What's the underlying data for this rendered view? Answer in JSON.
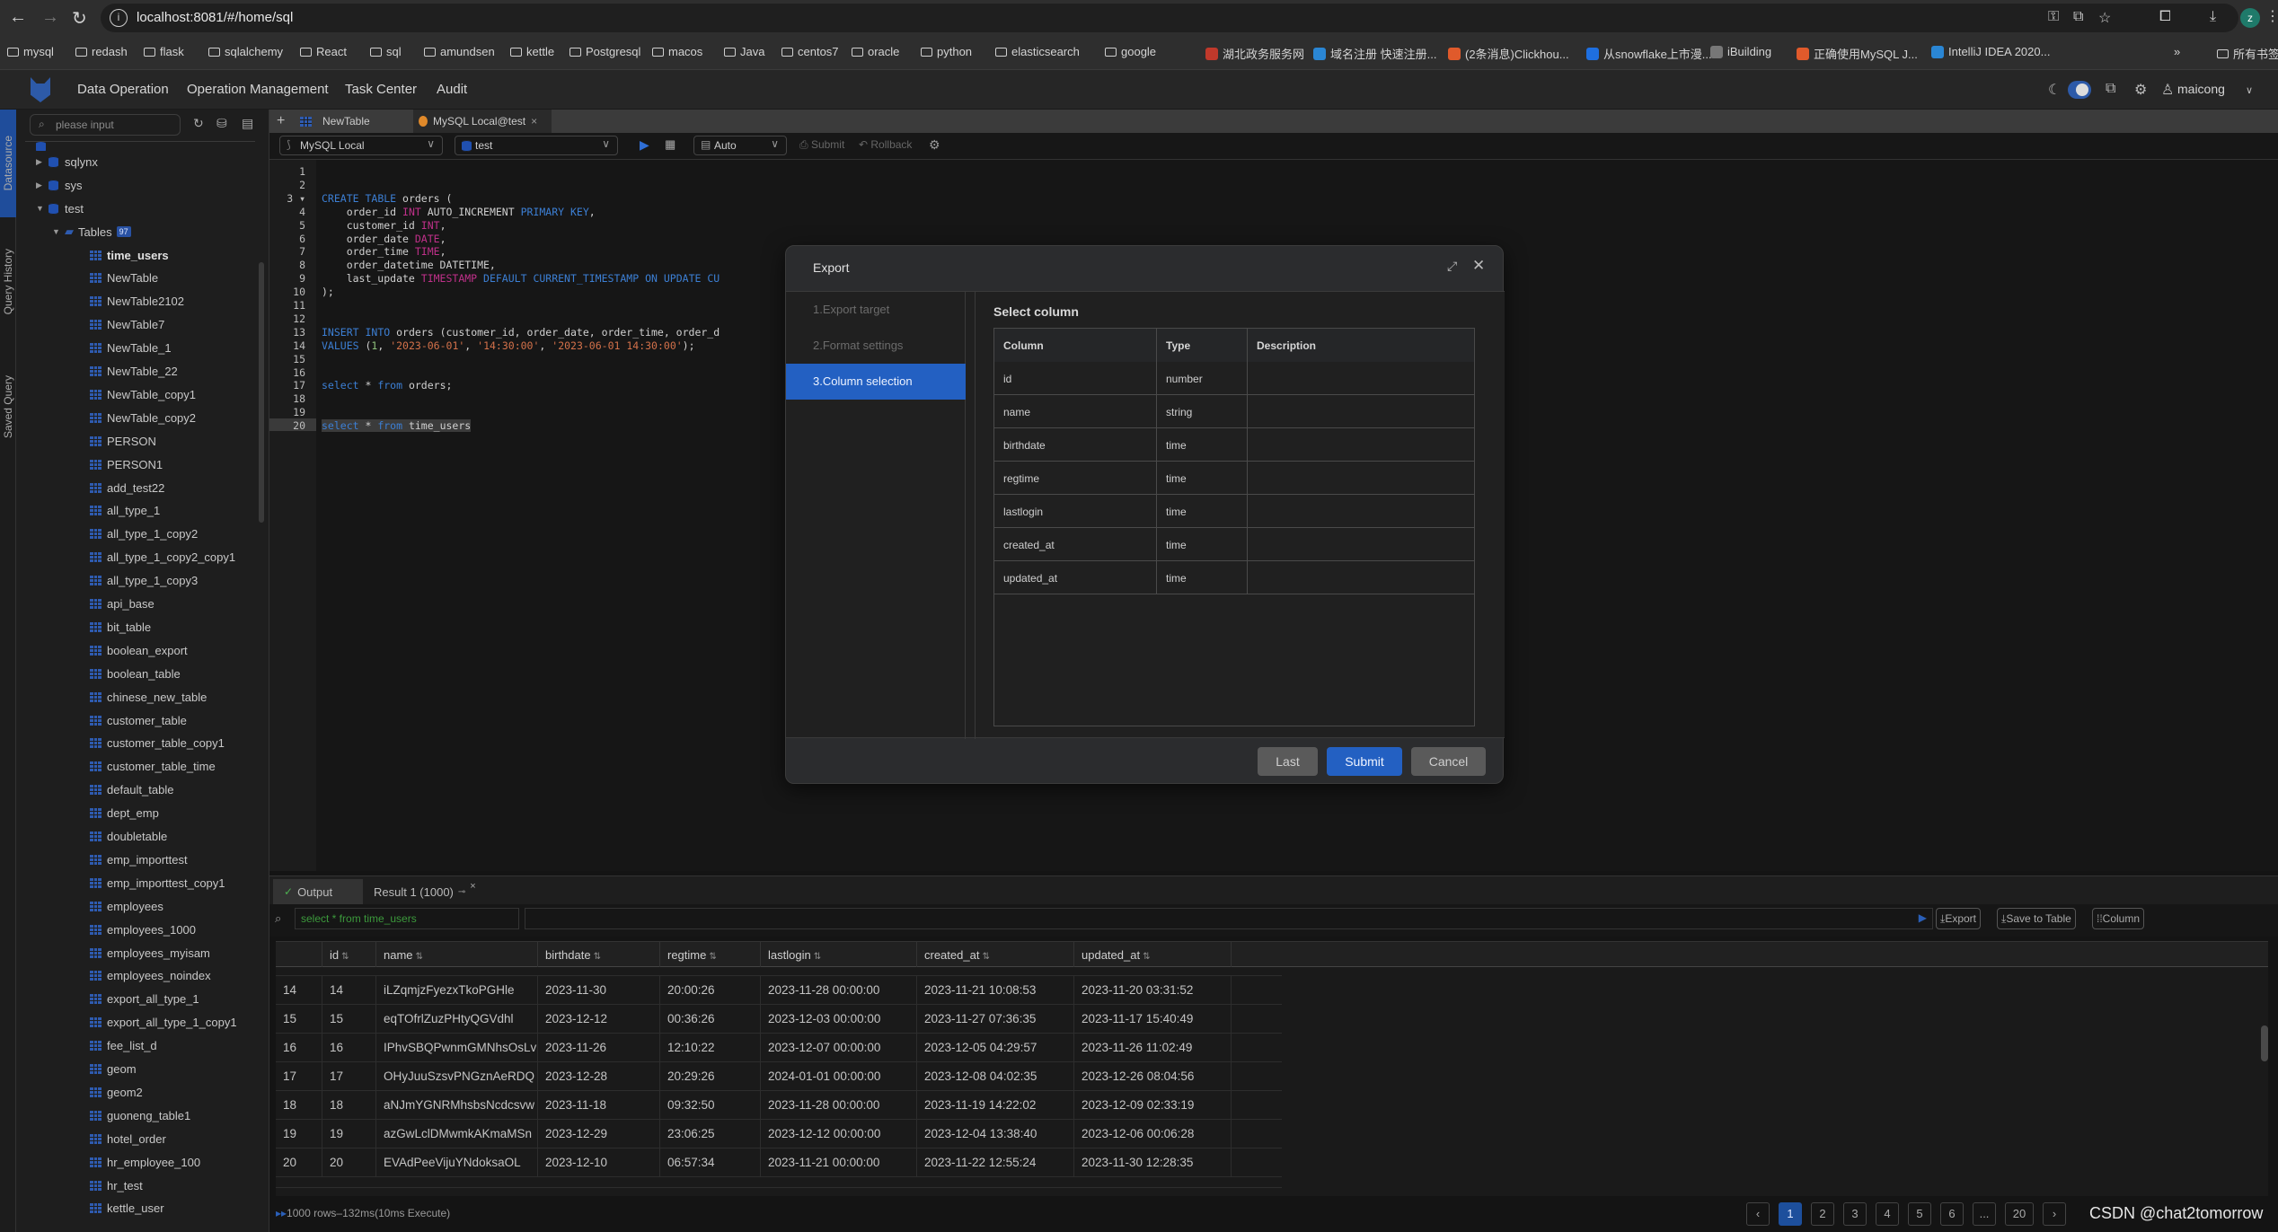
{
  "browser": {
    "url": "localhost:8081/#/home/sql",
    "avatar_letter": "z",
    "bookmarks": [
      {
        "label": "mysql",
        "type": "folder"
      },
      {
        "label": "redash",
        "type": "folder"
      },
      {
        "label": "flask",
        "type": "folder"
      },
      {
        "label": "sqlalchemy",
        "type": "folder"
      },
      {
        "label": "React",
        "type": "folder"
      },
      {
        "label": "sql",
        "type": "folder"
      },
      {
        "label": "amundsen",
        "type": "folder"
      },
      {
        "label": "kettle",
        "type": "folder"
      },
      {
        "label": "Postgresql",
        "type": "folder"
      },
      {
        "label": "macos",
        "type": "folder"
      },
      {
        "label": "Java",
        "type": "folder"
      },
      {
        "label": "centos7",
        "type": "folder"
      },
      {
        "label": "oracle",
        "type": "folder"
      },
      {
        "label": "python",
        "type": "folder"
      },
      {
        "label": "elasticsearch",
        "type": "folder"
      },
      {
        "label": "google",
        "type": "folder"
      },
      {
        "label": "湖北政务服务网",
        "type": "site"
      },
      {
        "label": "域名注册 快速注册...",
        "type": "site"
      },
      {
        "label": "(2条消息)Clickhou...",
        "type": "site"
      },
      {
        "label": "从snowflake上市漫...",
        "type": "site"
      },
      {
        "label": "iBuilding",
        "type": "site"
      },
      {
        "label": "正确使用MySQL J...",
        "type": "site"
      },
      {
        "label": "IntelliJ IDEA 2020...",
        "type": "site"
      }
    ],
    "more_bookmarks": "»",
    "all_bookmarks": "所有书签"
  },
  "app": {
    "nav": [
      "Data Operation",
      "Operation Management",
      "Task Center",
      "Audit"
    ],
    "user": "maicong"
  },
  "rail": [
    "Datasource",
    "Query History",
    "Saved Query"
  ],
  "sidebar": {
    "search_placeholder": "please input",
    "databases": [
      {
        "name": "sqlynx",
        "expanded": false
      },
      {
        "name": "sys",
        "expanded": false
      },
      {
        "name": "test",
        "expanded": true
      }
    ],
    "tables_label": "Tables",
    "tables_count": "97",
    "tables": [
      "time_users",
      "NewTable",
      "NewTable2102",
      "NewTable7",
      "NewTable_1",
      "NewTable_22",
      "NewTable_copy1",
      "NewTable_copy2",
      "PERSON",
      "PERSON1",
      "add_test22",
      "all_type_1",
      "all_type_1_copy2",
      "all_type_1_copy2_copy1",
      "all_type_1_copy3",
      "api_base",
      "bit_table",
      "boolean_export",
      "boolean_table",
      "chinese_new_table",
      "customer_table",
      "customer_table_copy1",
      "customer_table_time",
      "default_table",
      "dept_emp",
      "doubletable",
      "emp_importtest",
      "emp_importtest_copy1",
      "employees",
      "employees_1000",
      "employees_myisam",
      "employees_noindex",
      "export_all_type_1",
      "export_all_type_1_copy1",
      "fee_list_d",
      "geom",
      "geom2",
      "guoneng_table1",
      "hotel_order",
      "hr_employee_100",
      "hr_test",
      "kettle_user"
    ]
  },
  "editor": {
    "tabs": [
      {
        "label": "NewTable",
        "active": false
      },
      {
        "label": "MySQL Local@test",
        "active": true
      }
    ],
    "datasource": "MySQL Local",
    "database": "test",
    "commit_mode": "Auto",
    "submit_label": "Submit",
    "rollback_label": "Rollback",
    "lines": [
      "",
      "",
      "CREATE TABLE orders (",
      "    order_id INT AUTO_INCREMENT PRIMARY KEY,",
      "    customer_id INT,",
      "    order_date DATE,",
      "    order_time TIME,",
      "    order_datetime DATETIME,",
      "    last_update TIMESTAMP DEFAULT CURRENT_TIMESTAMP ON UPDATE CU",
      ");",
      "",
      "",
      "INSERT INTO orders (customer_id, order_date, order_time, order_d",
      "VALUES (1, '2023-06-01', '14:30:00', '2023-06-01 14:30:00');",
      "",
      "",
      "select * from orders;",
      "",
      "",
      "select * from time_users"
    ],
    "current_line": 20
  },
  "dialog": {
    "title": "Export",
    "steps": [
      {
        "label": "1.Export target",
        "active": false
      },
      {
        "label": "2.Format settings",
        "active": false
      },
      {
        "label": "3.Column selection",
        "active": true
      }
    ],
    "heading": "Select column",
    "table_headers": [
      "Column",
      "Type",
      "Description"
    ],
    "columns": [
      {
        "column": "id",
        "type": "number",
        "description": ""
      },
      {
        "column": "name",
        "type": "string",
        "description": ""
      },
      {
        "column": "birthdate",
        "type": "time",
        "description": ""
      },
      {
        "column": "regtime",
        "type": "time",
        "description": ""
      },
      {
        "column": "lastlogin",
        "type": "time",
        "description": ""
      },
      {
        "column": "created_at",
        "type": "time",
        "description": ""
      },
      {
        "column": "updated_at",
        "type": "time",
        "description": ""
      }
    ],
    "buttons": {
      "last": "Last",
      "submit": "Submit",
      "cancel": "Cancel"
    },
    "accent": "#2360c2"
  },
  "results": {
    "tabs": [
      {
        "label": "Output"
      },
      {
        "label": "Result 1 (1000)"
      }
    ],
    "query": "select * from time_users",
    "buttons": {
      "export": "Export",
      "save_to_table": "Save to Table",
      "column": "Column"
    },
    "headers": [
      "",
      "id",
      "name",
      "birthdate",
      "regtime",
      "lastlogin",
      "created_at",
      "updated_at"
    ],
    "rows": [
      [
        "14",
        "14",
        "iLZqmjzFyezxTkoPGHle",
        "2023-11-30",
        "20:00:26",
        "2023-11-28 00:00:00",
        "2023-11-21 10:08:53",
        "2023-11-20 03:31:52"
      ],
      [
        "15",
        "15",
        "eqTOfrlZuzPHtyQGVdhl",
        "2023-12-12",
        "00:36:26",
        "2023-12-03 00:00:00",
        "2023-11-27 07:36:35",
        "2023-11-17 15:40:49"
      ],
      [
        "16",
        "16",
        "IPhvSBQPwnmGMNhsOsLv",
        "2023-11-26",
        "12:10:22",
        "2023-12-07 00:00:00",
        "2023-12-05 04:29:57",
        "2023-11-26 11:02:49"
      ],
      [
        "17",
        "17",
        "OHyJuuSzsvPNGznAeRDQ",
        "2023-12-28",
        "20:29:26",
        "2024-01-01 00:00:00",
        "2023-12-08 04:02:35",
        "2023-12-26 08:04:56"
      ],
      [
        "18",
        "18",
        "aNJmYGNRMhsbsNcdcsvw",
        "2023-11-18",
        "09:32:50",
        "2023-11-28 00:00:00",
        "2023-11-19 14:22:02",
        "2023-12-09 02:33:19"
      ],
      [
        "19",
        "19",
        "azGwLclDMwmkAKmaMSn",
        "2023-12-29",
        "23:06:25",
        "2023-12-12 00:00:00",
        "2023-12-04 13:38:40",
        "2023-12-06 00:06:28"
      ],
      [
        "20",
        "20",
        "EVAdPeeVijuYNdoksaOL",
        "2023-12-10",
        "06:57:34",
        "2023-11-21 00:00:00",
        "2023-11-22 12:55:24",
        "2023-11-30 12:28:35"
      ]
    ],
    "status": "1000 rows–132ms(10ms Execute)",
    "pages": [
      "1",
      "2",
      "3",
      "4",
      "5",
      "6",
      "...",
      "20"
    ],
    "current_page": "1"
  },
  "watermark": "CSDN @chat2tomorrow"
}
